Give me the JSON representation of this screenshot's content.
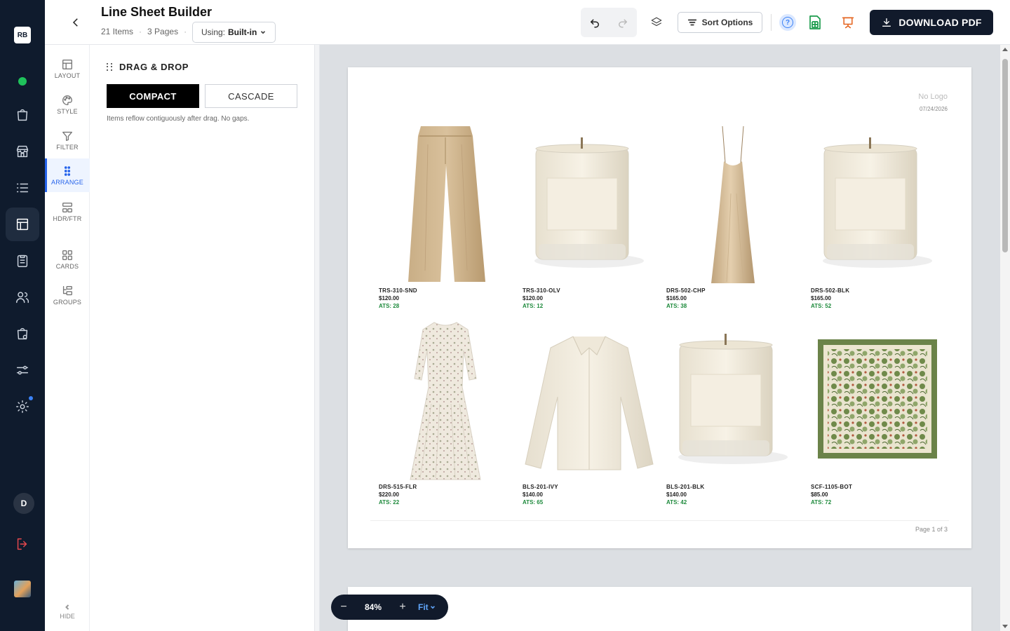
{
  "rail": {
    "logo": "RB",
    "user_initial": "D"
  },
  "header": {
    "title": "Line Sheet Builder",
    "items_count": "21 Items",
    "pages_count": "3 Pages",
    "using_label": "Using:",
    "using_value": "Built-in",
    "sort_label": "Sort Options",
    "download_label": "DOWNLOAD PDF"
  },
  "tools": [
    {
      "label": "LAYOUT",
      "icon": "layout-icon"
    },
    {
      "label": "STYLE",
      "icon": "palette-icon"
    },
    {
      "label": "FILTER",
      "icon": "filter-icon"
    },
    {
      "label": "ARRANGE",
      "icon": "grip-icon",
      "active": true
    },
    {
      "label": "HDR/FTR",
      "icon": "header-footer-icon"
    },
    {
      "label": "CARDS",
      "icon": "grid-icon"
    },
    {
      "label": "GROUPS",
      "icon": "groups-icon"
    }
  ],
  "hide_label": "HIDE",
  "panel": {
    "heading": "DRAG & DROP",
    "mode_compact": "COMPACT",
    "mode_cascade": "CASCADE",
    "selected_mode": "COMPACT",
    "hint": "Items reflow contiguously after drag. No gaps."
  },
  "page": {
    "no_logo": "No Logo",
    "date": "07/24/2026",
    "footer": "Page 1 of 3"
  },
  "products": [
    {
      "sku": "TRS-310-SND",
      "price": "$120.00",
      "ats": "ATS: 28",
      "kind": "pants"
    },
    {
      "sku": "TRS-310-OLV",
      "price": "$120.00",
      "ats": "ATS: 12",
      "kind": "candle"
    },
    {
      "sku": "DRS-502-CHP",
      "price": "$165.00",
      "ats": "ATS: 38",
      "kind": "slipdress"
    },
    {
      "sku": "DRS-502-BLK",
      "price": "$165.00",
      "ats": "ATS: 52",
      "kind": "candle"
    },
    {
      "sku": "DRS-515-FLR",
      "price": "$220.00",
      "ats": "ATS: 22",
      "kind": "floraldress"
    },
    {
      "sku": "BLS-201-IVY",
      "price": "$140.00",
      "ats": "ATS: 65",
      "kind": "blouse"
    },
    {
      "sku": "BLS-201-BLK",
      "price": "$140.00",
      "ats": "ATS: 42",
      "kind": "candle"
    },
    {
      "sku": "SCF-1105-BOT",
      "price": "$85.00",
      "ats": "ATS: 72",
      "kind": "scarf"
    }
  ],
  "zoom": {
    "level": "84%",
    "fit_label": "Fit",
    "minus": "−",
    "plus": "+"
  },
  "colors": {
    "rail_bg": "#0f1b2d",
    "accent": "#2563eb",
    "ats_green": "#1e8a3c",
    "download_bg": "#111a2b"
  }
}
